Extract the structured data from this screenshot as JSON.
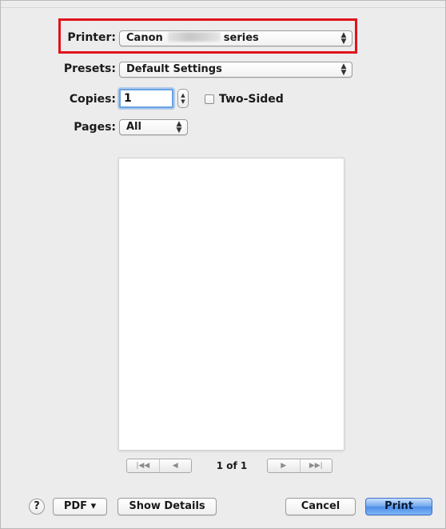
{
  "dialog": {
    "printer": {
      "label": "Printer:",
      "brand": "Canon",
      "suffix": "series"
    },
    "presets": {
      "label": "Presets:",
      "value": "Default Settings"
    },
    "copies": {
      "label": "Copies:",
      "value": "1"
    },
    "two_sided": {
      "label": "Two-Sided",
      "checked": false
    },
    "pages": {
      "label": "Pages:",
      "value": "All"
    },
    "preview": {
      "page_indicator": "1 of 1"
    },
    "footer": {
      "help_label": "?",
      "pdf_label": "PDF ▾",
      "show_details_label": "Show Details",
      "cancel_label": "Cancel",
      "print_label": "Print"
    }
  },
  "icons": {
    "popup_chevron": "updown-chevron-icon",
    "first_page": "first-page-icon",
    "previous_page": "previous-page-icon",
    "next_page": "next-page-icon",
    "last_page": "last-page-icon"
  },
  "colors": {
    "highlight": "#e0131c",
    "default_button": "#4c8ce8",
    "focus_ring": "#6aa3e3"
  }
}
